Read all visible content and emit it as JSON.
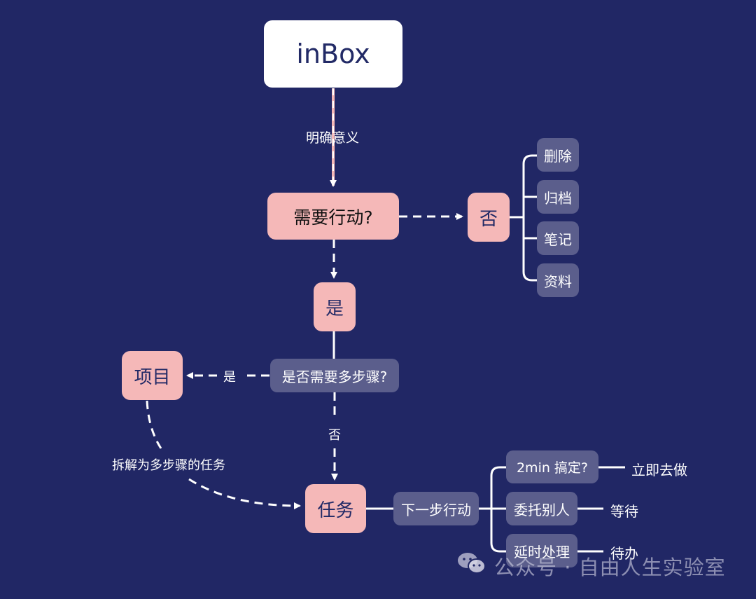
{
  "diagram": {
    "inbox": "inBox",
    "clarify_label": "明确意义",
    "need_action": "需要行动?",
    "no": "否",
    "no_options": [
      "删除",
      "归档",
      "笔记",
      "资料"
    ],
    "yes": "是",
    "multi_step": "是否需要多步骤?",
    "yes_edge_label": "是",
    "project": "项目",
    "no_edge_label": "否",
    "decompose_label": "拆解为多步骤的任务",
    "task": "任务",
    "next_action": "下一步行动",
    "branches": [
      {
        "label": "2min 搞定?",
        "result": "立即去做"
      },
      {
        "label": "委托别人",
        "result": "等待"
      },
      {
        "label": "延时处理",
        "result": "待办"
      }
    ]
  },
  "watermark": {
    "icon": "wechat-icon",
    "text": "公众号 · 自由人生实验室"
  },
  "colors": {
    "background": "#212765",
    "pink_node": "#f5b8b8",
    "slate_node": "#5b5e8c",
    "text_dark": "#222a66"
  }
}
